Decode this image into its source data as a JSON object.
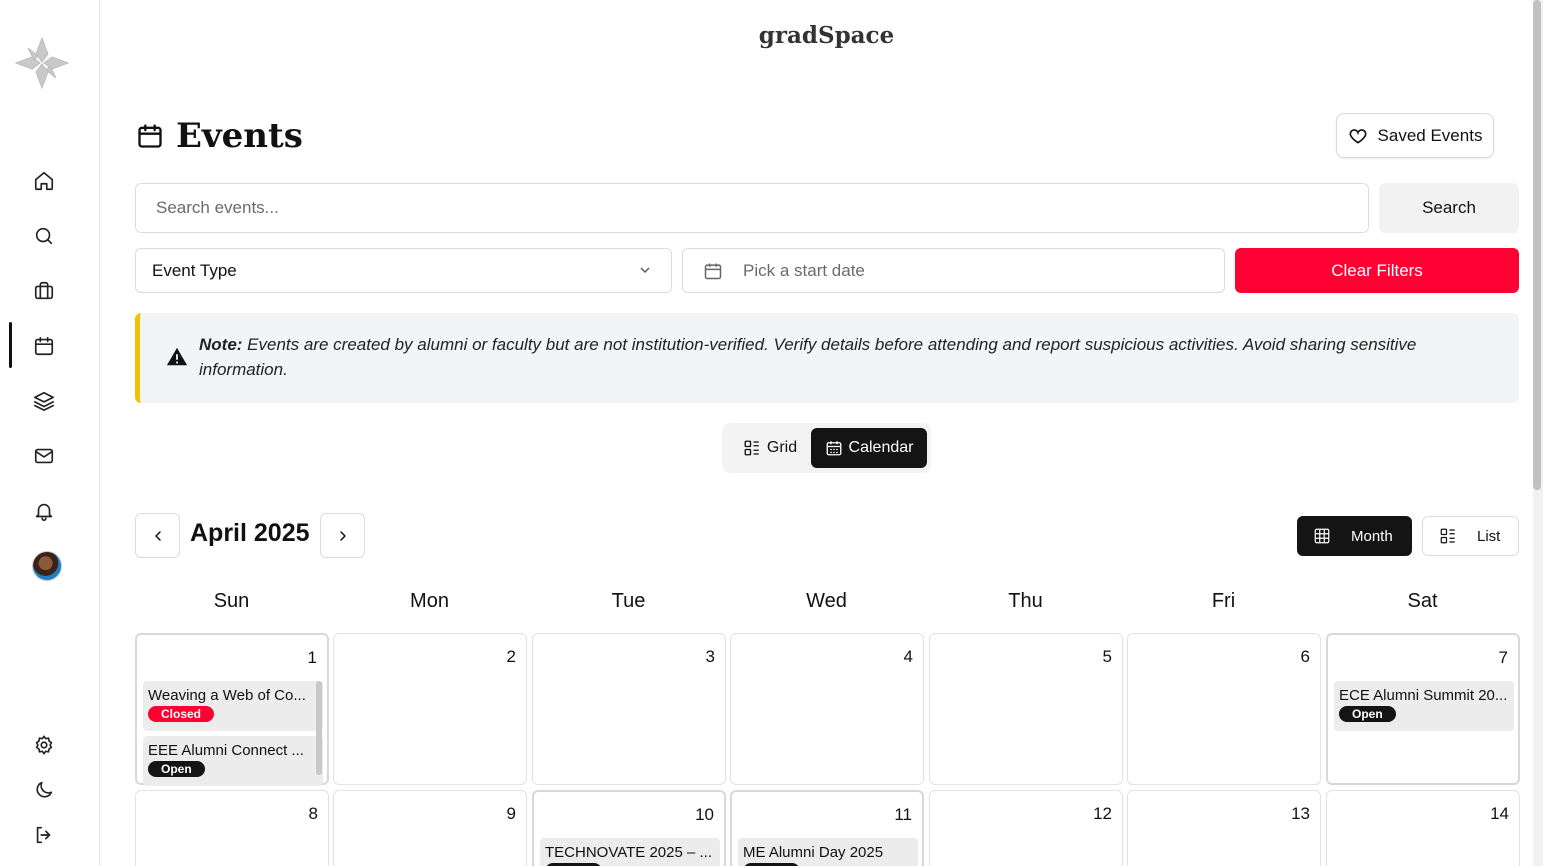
{
  "app": {
    "brand": "gradSpace"
  },
  "sidebar": {
    "items": [
      {
        "name": "home",
        "icon": "home-icon"
      },
      {
        "name": "search",
        "icon": "search-icon"
      },
      {
        "name": "jobs",
        "icon": "briefcase-icon"
      },
      {
        "name": "events",
        "icon": "calendar-icon",
        "active": true
      },
      {
        "name": "resources",
        "icon": "layers-icon"
      },
      {
        "name": "messages",
        "icon": "mail-icon"
      },
      {
        "name": "notifications",
        "icon": "bell-icon"
      }
    ],
    "bottom": [
      "gear-icon",
      "moon-icon",
      "logout-icon"
    ]
  },
  "page": {
    "title": "Events",
    "saved_events_label": "Saved Events"
  },
  "search": {
    "placeholder": "Search events...",
    "button_label": "Search"
  },
  "filters": {
    "event_type_label": "Event Type",
    "date_placeholder": "Pick a start date",
    "clear_label": "Clear Filters"
  },
  "note": {
    "prefix": "Note:",
    "text": " Events are created by alumni or faculty but are not institution-verified. Verify details before attending and report suspicious activities. Avoid sharing sensitive information."
  },
  "view_toggle": {
    "grid_label": "Grid",
    "calendar_label": "Calendar",
    "selected": "Calendar"
  },
  "calendar": {
    "month_label": "April 2025",
    "mode_month_label": "Month",
    "mode_list_label": "List",
    "selected_mode": "Month",
    "weekdays": [
      "Sun",
      "Mon",
      "Tue",
      "Wed",
      "Thu",
      "Fri",
      "Sat"
    ],
    "week1": [
      {
        "day": "1",
        "events": [
          {
            "title": "Weaving a Web of Co...",
            "status": "Closed"
          },
          {
            "title": "EEE Alumni Connect ...",
            "status": "Open"
          }
        ]
      },
      {
        "day": "2",
        "events": []
      },
      {
        "day": "3",
        "events": []
      },
      {
        "day": "4",
        "events": []
      },
      {
        "day": "5",
        "events": []
      },
      {
        "day": "6",
        "events": []
      },
      {
        "day": "7",
        "events": [
          {
            "title": "ECE Alumni Summit 20...",
            "status": "Open"
          }
        ]
      }
    ],
    "week2": [
      {
        "day": "8",
        "events": []
      },
      {
        "day": "9",
        "events": []
      },
      {
        "day": "10",
        "events": [
          {
            "title": "TECHNOVATE 2025 – ...",
            "status": "Open"
          }
        ]
      },
      {
        "day": "11",
        "events": [
          {
            "title": "ME Alumni Day 2025",
            "status": "Open"
          }
        ]
      },
      {
        "day": "12",
        "events": []
      },
      {
        "day": "13",
        "events": []
      },
      {
        "day": "14",
        "events": []
      }
    ]
  },
  "colors": {
    "danger": "#ff0033",
    "dark": "#141414",
    "warning_border": "#f2c200",
    "note_bg": "#f3f4f6"
  }
}
